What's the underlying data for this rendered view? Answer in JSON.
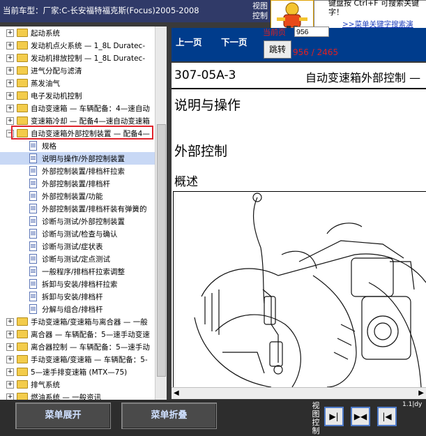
{
  "header": {
    "car_title": "当前车型：厂家:C-长安福特福克斯(Focus)2005-2008",
    "view_control": "视图控制",
    "tip_text": "键盘按 Ctrl+F 可搜索关键字！",
    "tip_link": ">>菜单关键字搜索演"
  },
  "tree": {
    "items": [
      {
        "label": "起动系统",
        "type": "folder",
        "level": 0
      },
      {
        "label": "发动机点火系统 — 1_8L Duratec-",
        "type": "folder",
        "level": 0
      },
      {
        "label": "发动机排放控制 — 1_8L Duratec-",
        "type": "folder",
        "level": 0
      },
      {
        "label": "进气分配与滤清",
        "type": "folder",
        "level": 0
      },
      {
        "label": "蒸发油气",
        "type": "folder",
        "level": 0
      },
      {
        "label": "电子发动机控制",
        "type": "folder",
        "level": 0
      },
      {
        "label": "自动变速箱 — 车辆配备：4—速自动",
        "type": "folder",
        "level": 0
      },
      {
        "label": "变速箱冷却 — 配备4—速自动变速箱",
        "type": "folder",
        "level": 0
      },
      {
        "label": "自动变速箱外部控制装置 — 配备4—",
        "type": "folder-open",
        "level": 0
      },
      {
        "label": "规格",
        "type": "doc",
        "level": 1
      },
      {
        "label": "说明与操作/外部控制装置",
        "type": "doc",
        "level": 1,
        "selected": true
      },
      {
        "label": "外部控制装置/排档杆拉索",
        "type": "doc",
        "level": 1
      },
      {
        "label": "外部控制装置/排档杆",
        "type": "doc",
        "level": 1
      },
      {
        "label": "外部控制装置/功能",
        "type": "doc",
        "level": 1
      },
      {
        "label": "外部控制装置/排档杆装有弹簧的",
        "type": "doc",
        "level": 1
      },
      {
        "label": "诊断与测试/外部控制装置",
        "type": "doc",
        "level": 1
      },
      {
        "label": "诊断与测试/检查与确认",
        "type": "doc",
        "level": 1
      },
      {
        "label": "诊断与测试/症状表",
        "type": "doc",
        "level": 1
      },
      {
        "label": "诊断与测试/定点测试",
        "type": "doc",
        "level": 1
      },
      {
        "label": "一般程序/排档杆拉索调整",
        "type": "doc",
        "level": 1
      },
      {
        "label": "拆卸与安装/排档杆拉索",
        "type": "doc",
        "level": 1
      },
      {
        "label": "拆卸与安装/排档杆",
        "type": "doc",
        "level": 1
      },
      {
        "label": "分解与组合/排档杆",
        "type": "doc",
        "level": 1
      },
      {
        "label": "手动变速箱/变速箱与离合器 — 一般",
        "type": "folder",
        "level": 0
      },
      {
        "label": "离合器 — 车辆配备：5—速手动变速",
        "type": "folder",
        "level": 0
      },
      {
        "label": "离合器控制 — 车辆配备：5—速手动",
        "type": "folder",
        "level": 0
      },
      {
        "label": "手动变速箱/变速箱 — 车辆配备：5-",
        "type": "folder",
        "level": 0
      },
      {
        "label": "5—速手排变速箱 (MTX—75)",
        "type": "folder",
        "level": 0
      },
      {
        "label": "排气系统",
        "type": "folder",
        "level": 0
      },
      {
        "label": "燃油系统 — 一般资讯",
        "type": "folder",
        "level": 0
      }
    ]
  },
  "nav": {
    "prev": "上一页",
    "next": "下一页",
    "page_label": "当前页",
    "page_value": "956",
    "jump": "跳转",
    "page_count": "956 / 2465"
  },
  "document": {
    "code": "307-05A-3",
    "title": "自动变速箱外部控制 —",
    "section1": "说明与操作",
    "section2": "外部控制",
    "section3": "概述"
  },
  "bottom": {
    "expand": "菜单展开",
    "collapse": "菜单折叠",
    "view_control": "视图控制",
    "mini": "1.1|dy"
  }
}
